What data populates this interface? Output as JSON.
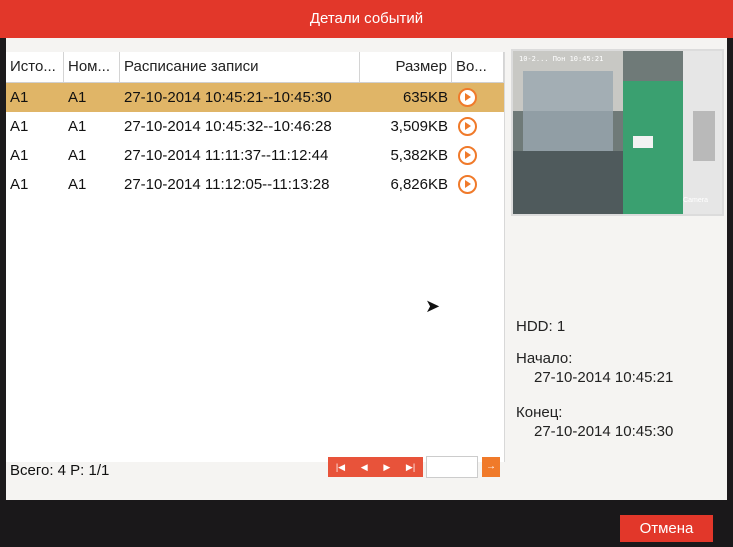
{
  "window": {
    "title": "Детали событий"
  },
  "table": {
    "headers": [
      "Исто...",
      "Ном...",
      "Расписание записи",
      "Размер",
      "Во..."
    ],
    "rows": [
      {
        "source": "A1",
        "number": "A1",
        "schedule": "27-10-2014 10:45:21--10:45:30",
        "size": "635KB",
        "selected": true
      },
      {
        "source": "A1",
        "number": "A1",
        "schedule": "27-10-2014 10:45:32--10:46:28",
        "size": "3,509KB",
        "selected": false
      },
      {
        "source": "A1",
        "number": "A1",
        "schedule": "27-10-2014 11:11:37--11:12:44",
        "size": "5,382KB",
        "selected": false
      },
      {
        "source": "A1",
        "number": "A1",
        "schedule": "27-10-2014 11:12:05--11:13:28",
        "size": "6,826KB",
        "selected": false
      }
    ]
  },
  "preview": {
    "overlay_text": "10-2... Пон 10:45:21",
    "camera_label": "Camera"
  },
  "details": {
    "hdd": "HDD: 1",
    "start_label": "Начало:",
    "start_value": "27-10-2014 10:45:21",
    "end_label": "Конец:",
    "end_value": "27-10-2014 10:45:30"
  },
  "footer": {
    "total": "Всего: 4  P: 1/1",
    "page_input": "",
    "go_glyph": "→"
  },
  "pager_glyphs": {
    "first": "|◀",
    "prev": "◀",
    "next": "▶",
    "last": "▶|"
  },
  "buttons": {
    "cancel": "Отмена"
  },
  "colors": {
    "accent": "#e2372a",
    "selected_row": "#e0b567",
    "play_icon": "#f07a2a"
  }
}
